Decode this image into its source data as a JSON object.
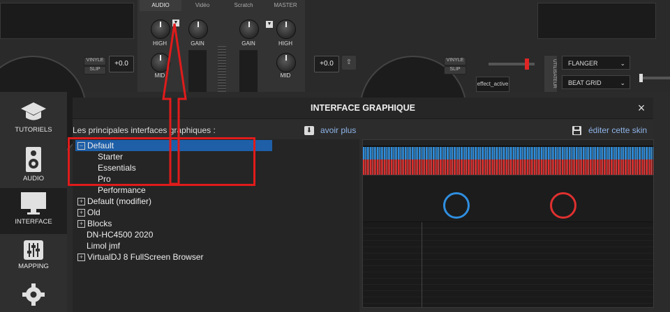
{
  "mixer": {
    "tabs": [
      "AUDIO",
      "Vidéo",
      "Scratch",
      "MASTER"
    ],
    "knobs": {
      "high_left": "HIGH",
      "gain_left": "GAIN",
      "gain_right": "GAIN",
      "high_right": "HIGH",
      "mid_left": "MID",
      "mid_right": "MID"
    }
  },
  "decks": {
    "left": {
      "vinyl": "VINYLE",
      "slip": "SLIP",
      "pitch": "+0.0"
    },
    "right": {
      "vinyl": "VINYLE",
      "slip": "SLIP",
      "pitch": "+0.0"
    }
  },
  "effects": {
    "fx1": "FLANGER",
    "fx2": "BEAT GRID",
    "effect_active": "effect_active",
    "util_label": "UTILISATEUR"
  },
  "sidebar": {
    "items": [
      {
        "label": "TUTORIELS",
        "icon": "graduation-cap-icon"
      },
      {
        "label": "AUDIO",
        "icon": "speaker-icon"
      },
      {
        "label": "INTERFACE",
        "icon": "monitor-icon"
      },
      {
        "label": "MAPPING",
        "icon": "sliders-icon"
      },
      {
        "label": "",
        "icon": "gear-icon"
      }
    ]
  },
  "dialog": {
    "title": "INTERFACE GRAPHIQUE",
    "close": "×",
    "heading": "Les principales interfaces graphiques :",
    "more_link": "avoir plus",
    "edit_link": "éditer cette skin",
    "tree": [
      {
        "label": "Default",
        "level": 0,
        "box": "−",
        "selected": true
      },
      {
        "label": "Starter",
        "level": 1
      },
      {
        "label": "Essentials",
        "level": 1
      },
      {
        "label": "Pro",
        "level": 1
      },
      {
        "label": "Performance",
        "level": 1
      },
      {
        "label": "Default (modifier)",
        "level": 0,
        "box": "+"
      },
      {
        "label": "Old",
        "level": 0,
        "box": "+"
      },
      {
        "label": "Blocks",
        "level": 0,
        "box": "+"
      },
      {
        "label": "DN-HC4500 2020",
        "level": 0
      },
      {
        "label": "Limol jmf",
        "level": 0
      },
      {
        "label": "VirtualDJ 8 FullScreen Browser",
        "level": 0,
        "box": "+"
      }
    ]
  },
  "colors": {
    "accent": "#1e5fa8",
    "link": "#8fb4e8",
    "annotation": "#e01b1b",
    "wave_blue": "#2f8fe0",
    "wave_red": "#e03030"
  }
}
